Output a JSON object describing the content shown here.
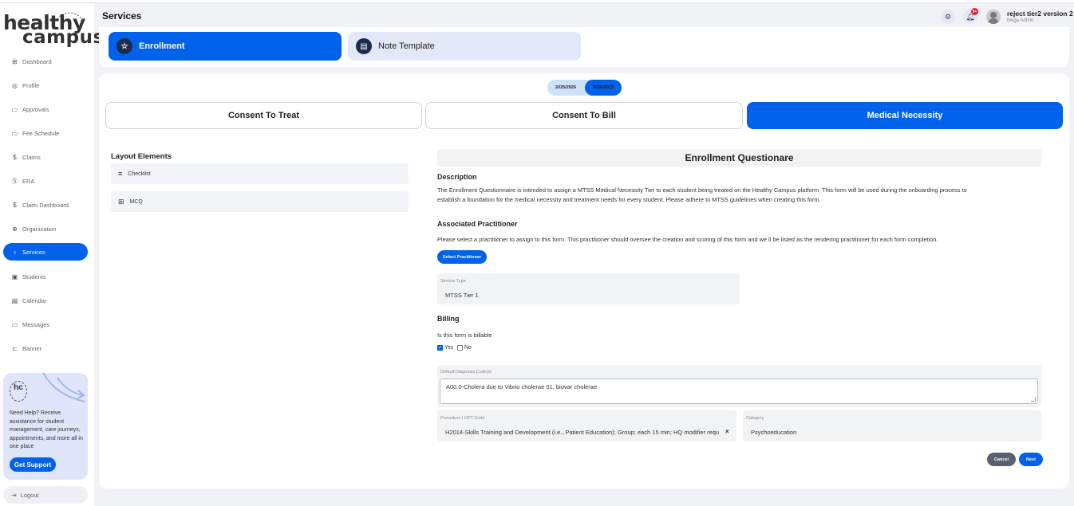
{
  "brand": {
    "line1": "healthy",
    "line2": "campus"
  },
  "header": {
    "title": "Services",
    "user_name": "reject tier2 version 2",
    "user_role": "Mega Admin",
    "notifications_count": "9+"
  },
  "sidebar": {
    "items": [
      {
        "label": "Dashboard",
        "icon": "grid-icon"
      },
      {
        "label": "Profile",
        "icon": "profile-icon"
      },
      {
        "label": "Approvals",
        "icon": "chat-icon"
      },
      {
        "label": "Fee Schedule",
        "icon": "chat-icon"
      },
      {
        "label": "Claims",
        "icon": "dollar-icon"
      },
      {
        "label": "ERA",
        "icon": "dollar-circle-icon"
      },
      {
        "label": "Claim Dashboard",
        "icon": "dollar-icon"
      },
      {
        "label": "Organization",
        "icon": "globe-icon"
      },
      {
        "label": "Services",
        "icon": "stethoscope-icon"
      },
      {
        "label": "Students",
        "icon": "student-icon"
      },
      {
        "label": "Calendar",
        "icon": "calendar-icon"
      },
      {
        "label": "Messages",
        "icon": "chat-icon"
      },
      {
        "label": "Banner",
        "icon": "banner-icon"
      }
    ],
    "help": {
      "text": "Need Help? Receive assistance for student management, care journeys, appointments, and more all in one place",
      "button": "Get Support",
      "badge": "hc"
    },
    "logout": "Logout"
  },
  "top_tabs": [
    {
      "label": "Enrollment"
    },
    {
      "label": "Note Template"
    }
  ],
  "years": [
    "2025/2026",
    "2026/2027"
  ],
  "form_tabs": [
    "Consent To Treat",
    "Consent To Bill",
    "Medical Necessity"
  ],
  "layout_elements": {
    "title": "Layout Elements",
    "items": [
      "Checklist",
      "MCQ"
    ]
  },
  "questionnaire": {
    "title": "Enrollment Questionare",
    "description_heading": "Description",
    "description_line1": "The Enrollment Questionnaire is intended to assign a MTSS Medical Necessity Tier to each student being treated on the Healthy Campus platform. This form will be used during the onboarding process to",
    "description_line2": "establish a foundation for the medical necessity and treatment needs for every student. Please adhere to MTSS guidelines when creating this form.",
    "practitioner_heading": "Associated Practitioner",
    "practitioner_text": "Please select a practitioner to assign to this form. This practitioner should oversee the creation and scoring of this form and we ll be listed as the rendering practitioner for each form completion.",
    "select_practitioner": "Select Practitioner",
    "service_type_label": "Service Type",
    "service_type_value": "MTSS Tier 1",
    "billing_heading": "Billing",
    "billing_question": "Is this form is billable",
    "yes_label": "Yes",
    "no_label": "No",
    "diagnosis_label": "Default Diagnosis Code(s)",
    "diagnosis_value": "A00.0-Cholera due to Vibrio cholerae 01, biovar cholerae",
    "procedure_label": "Procedure | CPT Code",
    "procedure_value": "H2014-Skills Training and Development (i.e., Patient Education); Group; each 15 min; HQ modifier requ",
    "category_label": "Category",
    "category_value": "Psychoeducation",
    "cancel": "Cancel",
    "next": "Next"
  }
}
